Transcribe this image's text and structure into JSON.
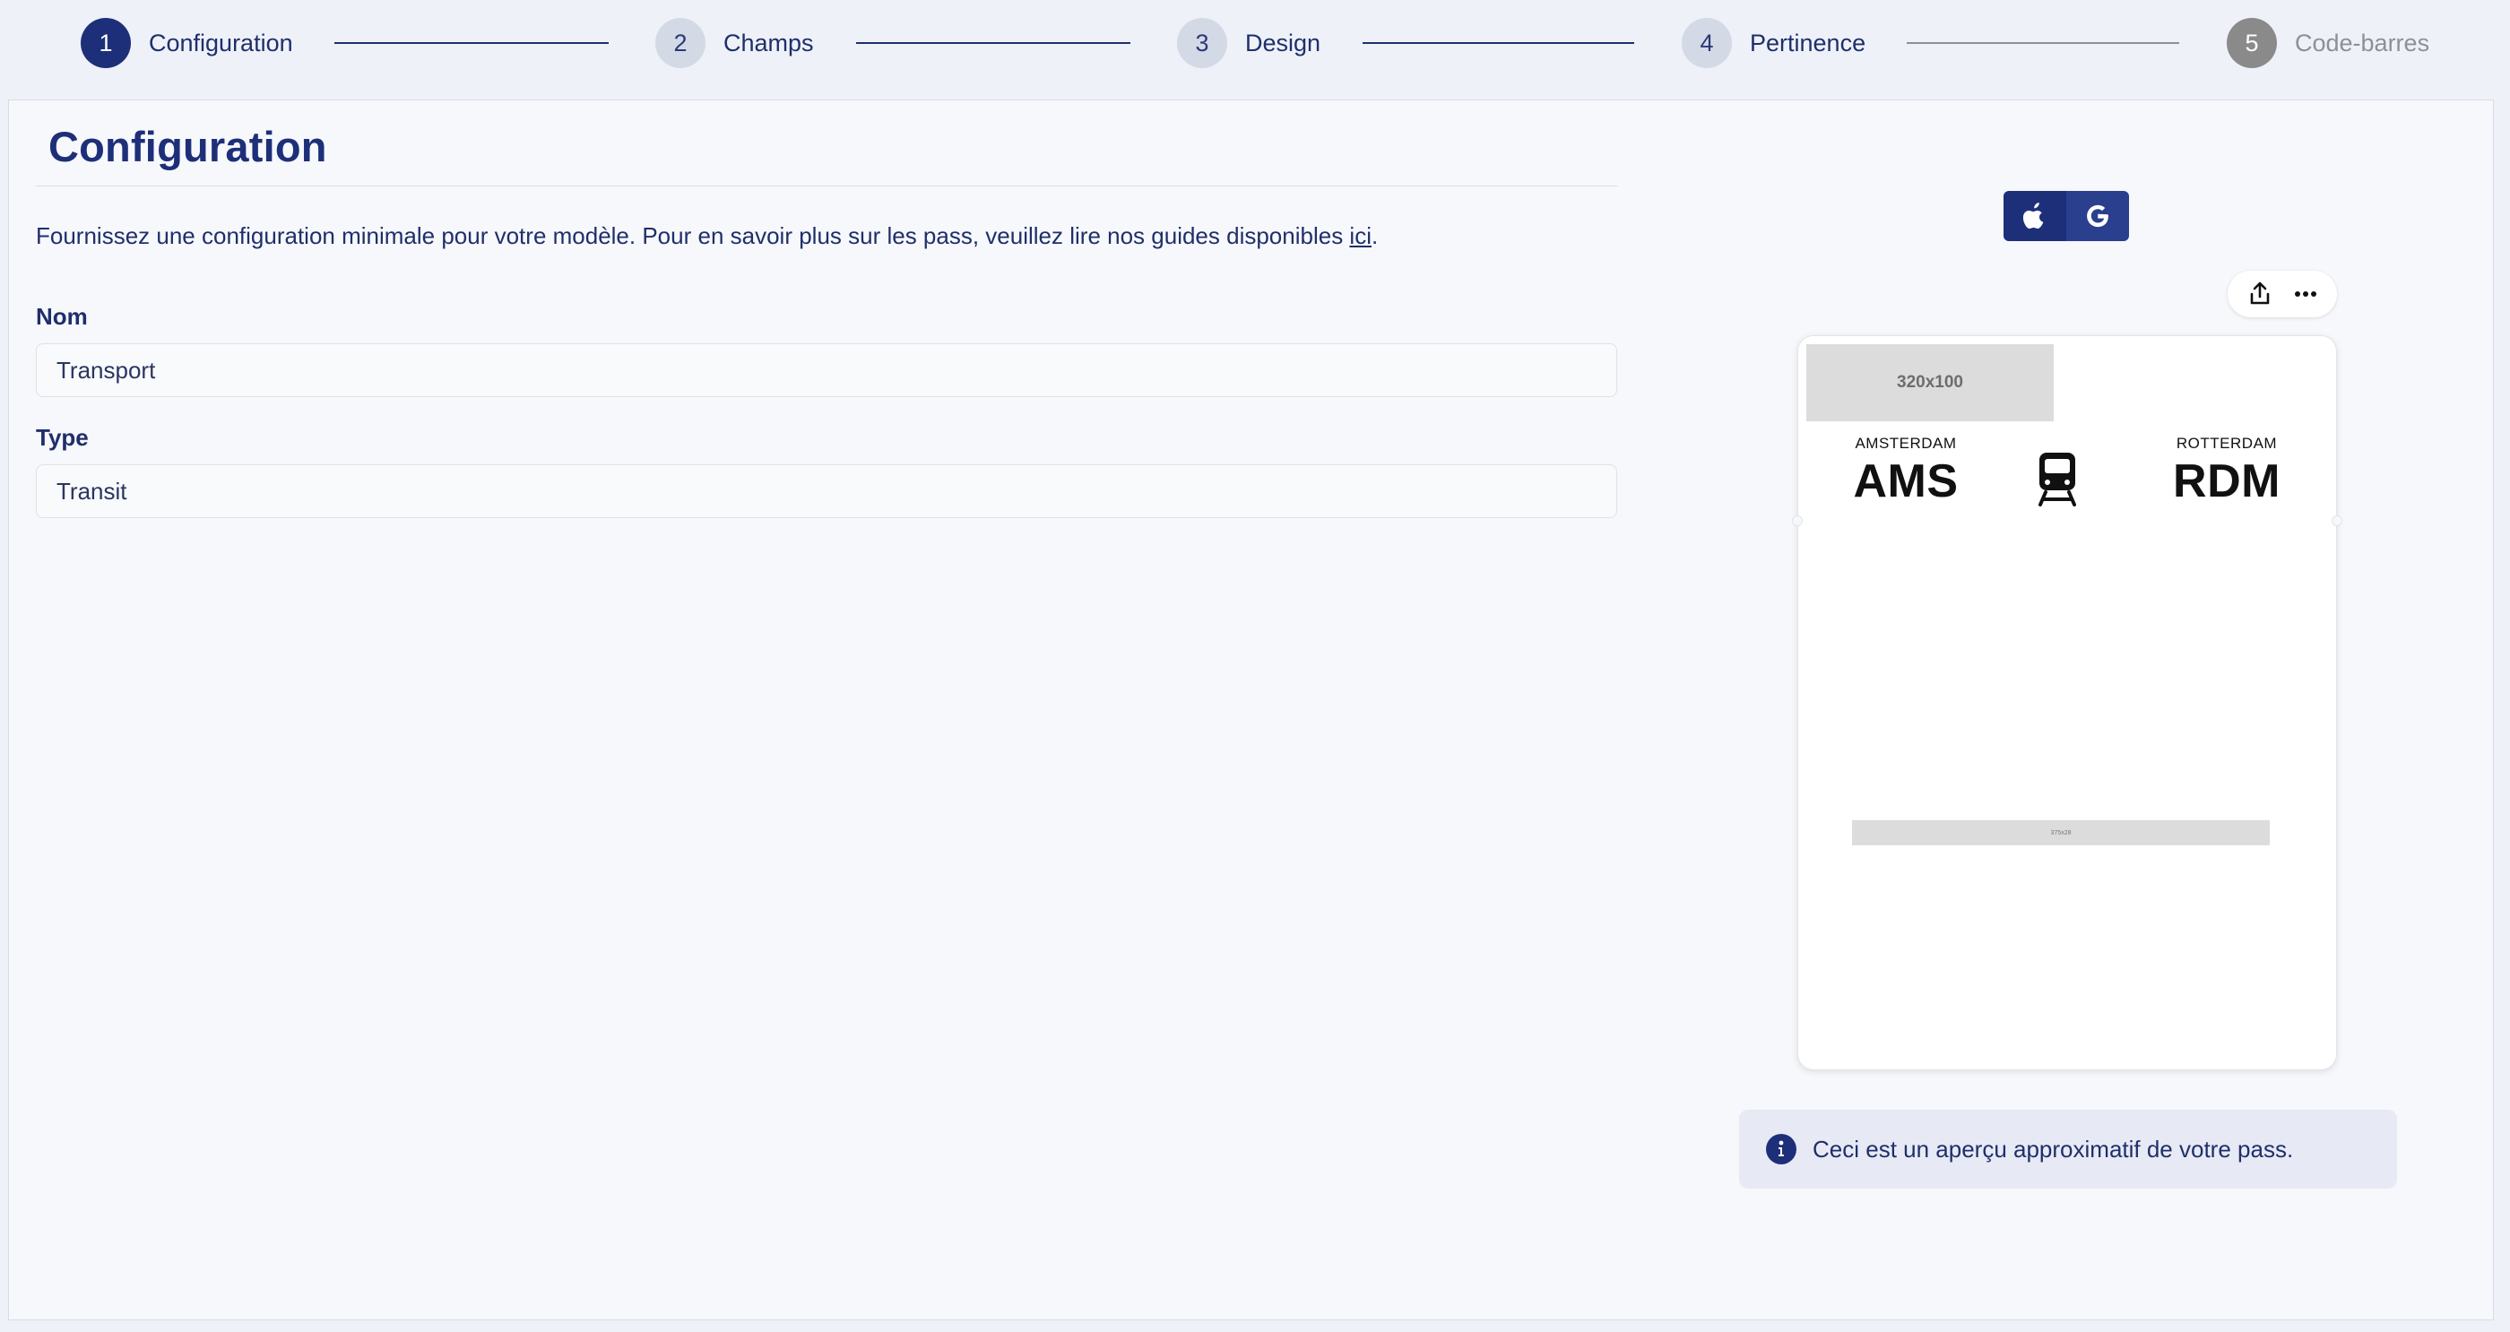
{
  "stepper": {
    "steps": [
      {
        "number": "1",
        "label": "Configuration",
        "state": "active"
      },
      {
        "number": "2",
        "label": "Champs",
        "state": "default"
      },
      {
        "number": "3",
        "label": "Design",
        "state": "default"
      },
      {
        "number": "4",
        "label": "Pertinence",
        "state": "default"
      },
      {
        "number": "5",
        "label": "Code-barres",
        "state": "disabled"
      }
    ]
  },
  "page": {
    "title": "Configuration",
    "intro_text": "Fournissez une configuration minimale pour votre modèle. Pour en savoir plus sur les pass, veuillez lire nos guides disponibles ",
    "intro_link": "ici",
    "intro_end": "."
  },
  "form": {
    "name_label": "Nom",
    "name_value": "Transport",
    "type_label": "Type",
    "type_value": "Transit"
  },
  "preview": {
    "platforms": [
      "apple-icon",
      "google-icon"
    ],
    "tools": [
      "share-icon",
      "more-icon"
    ],
    "pass": {
      "logo_placeholder": "320x100",
      "origin_city": "AMSTERDAM",
      "origin_code": "AMS",
      "transit_icon": "train-icon",
      "destination_city": "ROTTERDAM",
      "destination_code": "RDM",
      "barcode_placeholder": "375x28"
    },
    "info_text": "Ceci est un aperçu approximatif de votre pass."
  },
  "colors": {
    "primary": "#1e2f7a",
    "background": "#eef1f8",
    "panel": "#f7f8fb",
    "disabled": "#8a8a8a",
    "info_bg": "#e7eaf4"
  }
}
